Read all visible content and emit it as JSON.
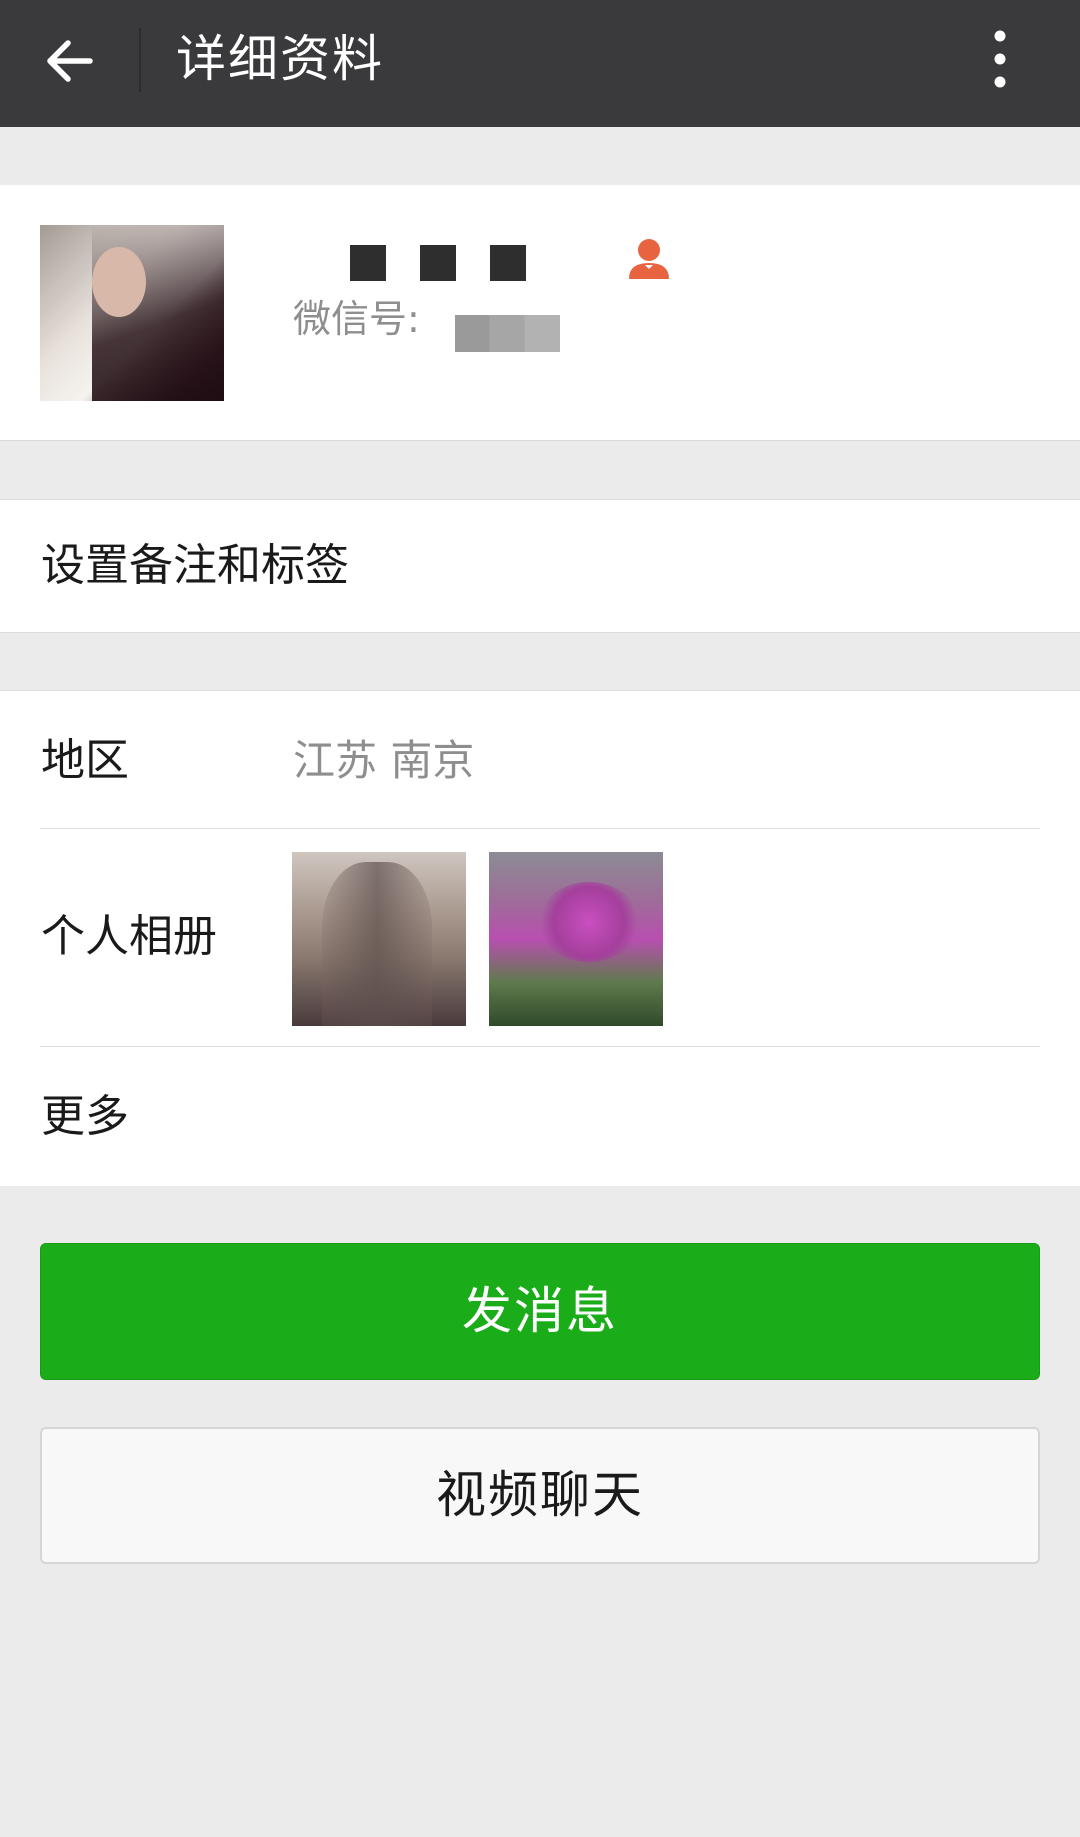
{
  "header": {
    "title": "详细资料",
    "back_icon": "arrow-left-icon",
    "more_icon": "more-vertical-icon"
  },
  "profile": {
    "name_redacted": true,
    "wechat_id_label": "微信号:",
    "wechat_id_redacted": true,
    "contact_icon": "contact-person-icon",
    "contact_icon_color": "#e8633f"
  },
  "remark": {
    "label": "设置备注和标签"
  },
  "info": {
    "region_label": "地区",
    "region_value": "江苏  南京",
    "album_label": "个人相册",
    "more_label": "更多"
  },
  "actions": {
    "send_message": "发消息",
    "video_chat": "视频聊天"
  },
  "colors": {
    "header_bg": "#3a3a3c",
    "primary": "#1aad19",
    "page_bg": "#ebebeb"
  }
}
